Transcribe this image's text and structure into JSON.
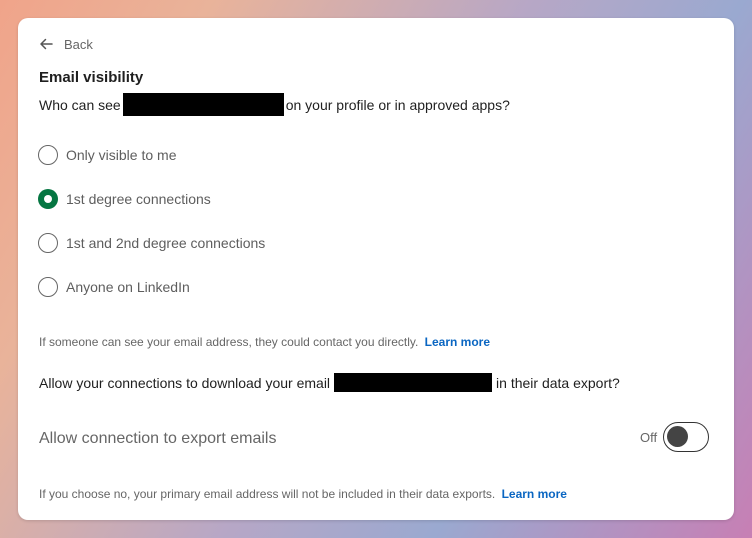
{
  "colors": {
    "accent": "#057642",
    "link": "#0a66c2"
  },
  "nav": {
    "back_label": "Back"
  },
  "section": {
    "title": "Email visibility",
    "question_prefix": "Who can see",
    "question_suffix": "on your profile or in approved apps?"
  },
  "options": [
    {
      "label": "Only visible to me",
      "selected": false
    },
    {
      "label": "1st degree connections",
      "selected": true
    },
    {
      "label": "1st and 2nd degree connections",
      "selected": false
    },
    {
      "label": "Anyone on LinkedIn",
      "selected": false
    }
  ],
  "contact_note": {
    "text": "If someone can see your email address, they could contact you directly.",
    "link": "Learn more"
  },
  "download": {
    "question_prefix": "Allow your connections to download your email",
    "question_suffix": "in their data export?"
  },
  "toggle": {
    "label": "Allow connection to export emails",
    "state_label": "Off",
    "on": false
  },
  "export_note": {
    "text": "If you choose no, your primary email address will not be included in their data exports.",
    "link": "Learn more"
  }
}
